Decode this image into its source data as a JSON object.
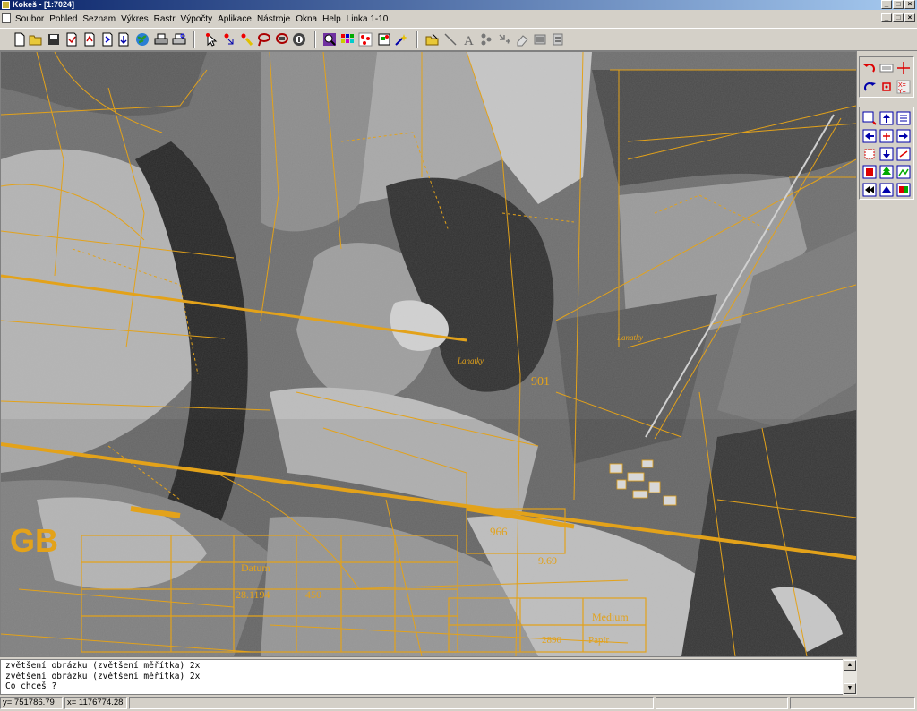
{
  "window": {
    "title": "Kokeš - [1:7024]"
  },
  "title_buttons": {
    "minimize": "_",
    "maximize": "□",
    "close": "×"
  },
  "menu": [
    "Soubor",
    "Pohled",
    "Seznam",
    "Výkres",
    "Rastr",
    "Výpočty",
    "Aplikace",
    "Nástroje",
    "Okna",
    "Help",
    "Linka 1-10"
  ],
  "map": {
    "overlay_color": "#e3a21a",
    "logo": "GB",
    "labels": {
      "parcel_901": "901",
      "parcel_966": "966",
      "parcel_969": "9.69",
      "lanatky": "Lanatky",
      "datum": "Datum",
      "medium": "Medium",
      "value_281194": "28.1194",
      "value_2890": "2890",
      "value_450": "450",
      "papir": "Papír"
    }
  },
  "console": {
    "lines": [
      "zvětšení obrázku (zvětšení měřítka) 2x",
      "zvětšení obrázku (zvětšení měřítka) 2x",
      "Co chceš ?"
    ]
  },
  "status": {
    "y": "y= 751786.79",
    "x": "x= 1176774.28"
  }
}
